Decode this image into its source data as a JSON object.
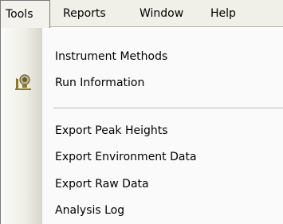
{
  "menubar": {
    "items": [
      {
        "label": "Tools",
        "active": true
      },
      {
        "label": "Reports",
        "active": false
      },
      {
        "label": "Window",
        "active": false
      },
      {
        "label": "Help",
        "active": false
      }
    ]
  },
  "dropdown": {
    "items": [
      {
        "label": "Instrument Methods"
      },
      {
        "label": "Run Information",
        "icon": "run-information-icon"
      },
      {
        "label": "Export Peak Heights"
      },
      {
        "label": "Export Environment Data"
      },
      {
        "label": "Export Raw Data"
      },
      {
        "label": "Analysis Log"
      }
    ]
  },
  "colors": {
    "menubar_bg": "#f0efe8",
    "menu_bg": "#fafafa",
    "icon_accent": "#8a7a2a"
  }
}
